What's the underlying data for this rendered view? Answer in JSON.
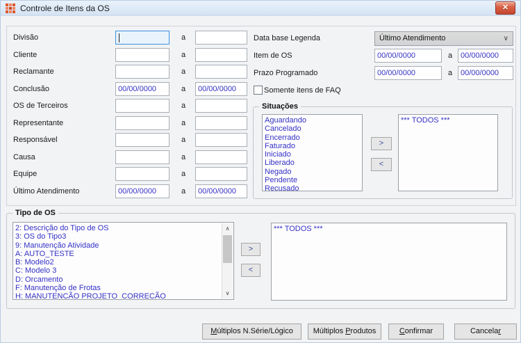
{
  "titlebar": {
    "title": "Controle de Itens da OS"
  },
  "icons": {
    "close": "✕",
    "combo_chevron": "∨",
    "scroll_up": "∧",
    "scroll_down": "∨"
  },
  "sep": "a",
  "filters": [
    {
      "label": "Divisão",
      "from": "",
      "to": ""
    },
    {
      "label": "Cliente",
      "from": "",
      "to": ""
    },
    {
      "label": "Reclamante",
      "from": "",
      "to": ""
    },
    {
      "label": "Conclusão",
      "from": "00/00/0000",
      "to": "00/00/0000"
    },
    {
      "label": "OS de Terceiros",
      "from": "",
      "to": ""
    },
    {
      "label": "Representante",
      "from": "",
      "to": ""
    },
    {
      "label": "Responsável",
      "from": "",
      "to": ""
    },
    {
      "label": "Causa",
      "from": "",
      "to": ""
    },
    {
      "label": "Equipe",
      "from": "",
      "to": ""
    },
    {
      "label": "Último Atendimento",
      "from": "00/00/0000",
      "to": "00/00/0000"
    }
  ],
  "legend": {
    "label": "Data base Legenda",
    "value": "Último Atendimento"
  },
  "item_os": {
    "label": "Item de OS",
    "from": "00/00/0000",
    "to": "00/00/0000"
  },
  "prazo": {
    "label": "Prazo Programado",
    "from": "00/00/0000",
    "to": "00/00/0000"
  },
  "faq": {
    "label": "Somente itens de FAQ",
    "checked": false
  },
  "situacoes": {
    "title": "Situações",
    "available": [
      "Aguardando",
      "Cancelado",
      "Encerrado",
      "Faturado",
      "Iniciado",
      "Liberado",
      "Negado",
      "Pendente",
      "Recusado"
    ],
    "selected": [
      "*** TODOS ***"
    ],
    "move_right": ">",
    "move_left": "<"
  },
  "tipo_os": {
    "title": "Tipo de OS",
    "available": [
      "2: Descrição do Tipo de OS",
      "3: OS do Tipo3",
      "9: Manutenção Atividade",
      "A: AUTO_TESTE",
      "B: Modelo2",
      "C: Modelo 3",
      "D: Orcamento",
      "F: Manutenção de Frotas",
      "H: MANUTENCÃO PROJETO  CORRECÃO"
    ],
    "selected": [
      "*** TODOS ***"
    ],
    "move_right": ">",
    "move_left": "<"
  },
  "footer": {
    "buttons": [
      {
        "pre": "",
        "key": "M",
        "post": "últiplos N.Série/Lógico"
      },
      {
        "pre": "Múltiplos ",
        "key": "P",
        "post": "rodutos"
      },
      {
        "pre": "",
        "key": "C",
        "post": "onfirmar"
      },
      {
        "pre": "Cancela",
        "key": "r",
        "post": ""
      }
    ]
  },
  "colors": {
    "accent_text": "#3431c4",
    "close_button_red": "#d95f43",
    "focus_border": "#3d8fe0",
    "titlebar_top": "#eaf2fb",
    "titlebar_bottom": "#d3e2f3"
  }
}
